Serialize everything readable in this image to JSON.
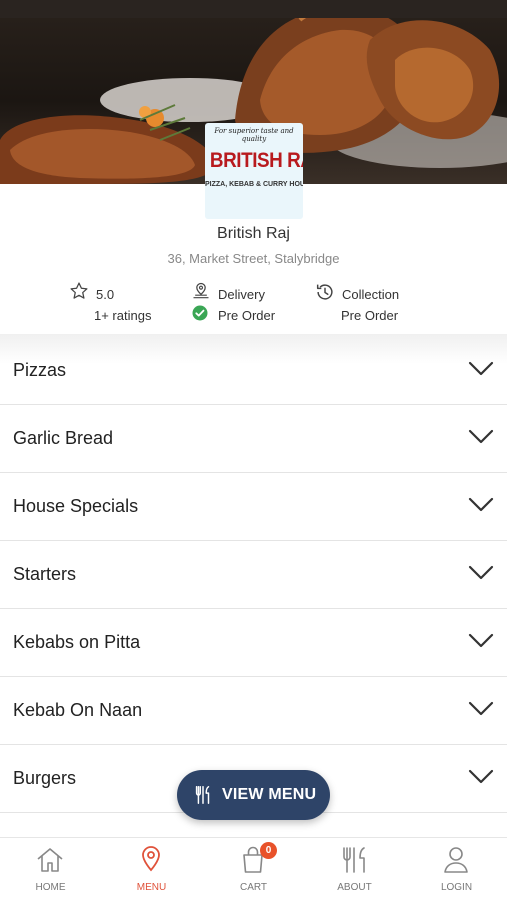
{
  "restaurant": {
    "logo_tagline": "For superior taste and quality",
    "logo_name": "BRITISH RAJ",
    "logo_subtitle": "PIZZA, KEBAB & CURRY HOUSE",
    "name": "British Raj",
    "address": "36, Market Street, Stalybridge"
  },
  "info": {
    "rating": {
      "value": "5.0",
      "count": "1+ ratings",
      "icon": "star-outline-icon"
    },
    "delivery": {
      "label": "Delivery",
      "status": "Pre Order",
      "icon": "delivery-location-icon",
      "status_icon": "check-circle-icon"
    },
    "collection": {
      "label": "Collection",
      "status": "Pre Order",
      "icon": "clock-history-icon"
    }
  },
  "categories": [
    {
      "label": "Pizzas"
    },
    {
      "label": "Garlic Bread"
    },
    {
      "label": "House Specials"
    },
    {
      "label": "Starters"
    },
    {
      "label": "Kebabs on Pitta"
    },
    {
      "label": "Kebab On Naan"
    },
    {
      "label": "Burgers"
    }
  ],
  "view_menu": {
    "label": "VIEW MENU",
    "icon": "fork-knife-icon"
  },
  "bottom_nav": {
    "items": [
      {
        "label": "HOME",
        "icon": "home-icon"
      },
      {
        "label": "MENU",
        "icon": "location-pin-icon",
        "active": true
      },
      {
        "label": "CART",
        "icon": "shopping-bag-icon",
        "badge": "0"
      },
      {
        "label": "ABOUT",
        "icon": "utensils-icon"
      },
      {
        "label": "LOGIN",
        "icon": "user-icon"
      }
    ]
  },
  "colors": {
    "accent": "#e0523a",
    "button_bg": "#2e4468",
    "check_green": "#3aa655",
    "logo_red": "#b81a1e"
  }
}
